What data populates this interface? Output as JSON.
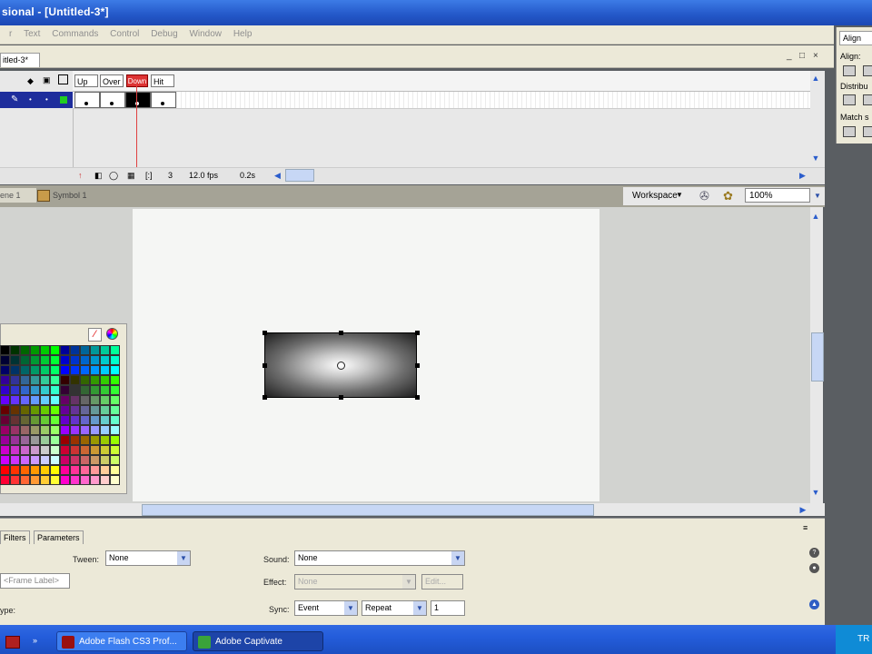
{
  "window": {
    "title": "sional - [Untitled-3*]"
  },
  "menu": [
    "r",
    "Text",
    "Commands",
    "Control",
    "Debug",
    "Window",
    "Help"
  ],
  "document": {
    "tab_label": "itled-3*",
    "win_controls": [
      "_",
      "□",
      "×"
    ]
  },
  "timeline": {
    "frame_labels": [
      "Up",
      "Over",
      "Down",
      "Hit"
    ],
    "status": {
      "current_frame": "3",
      "fps": "12.0 fps",
      "time": "0.2s"
    }
  },
  "edit_bar": {
    "scene": "ene 1",
    "symbol": "Symbol 1",
    "workspace": "Workspace",
    "zoom": "100%"
  },
  "properties": {
    "tabs": [
      "Filters",
      "Parameters"
    ],
    "frame_label_placeholder": "<Frame Label>",
    "tween_label": "Tween:",
    "tween_value": "None",
    "sound_label": "Sound:",
    "sound_value": "None",
    "effect_label": "Effect:",
    "effect_value": "None",
    "edit_label": "Edit...",
    "sync_label": "Sync:",
    "sync_value": "Event",
    "repeat_value": "Repeat",
    "repeat_count": "1",
    "type_label": "ype:"
  },
  "align_panel": {
    "tab": "Align",
    "align_label": "Align:",
    "distribute_label": "Distribu",
    "match_label": "Match s"
  },
  "taskbar": {
    "items": [
      "Adobe Flash CS3 Prof...",
      "Adobe Captivate"
    ],
    "clock": "TR"
  },
  "colors": {
    "selection_blue": "#1e2d9c",
    "playhead": "#e04040",
    "taskbar": "#245ddb"
  }
}
